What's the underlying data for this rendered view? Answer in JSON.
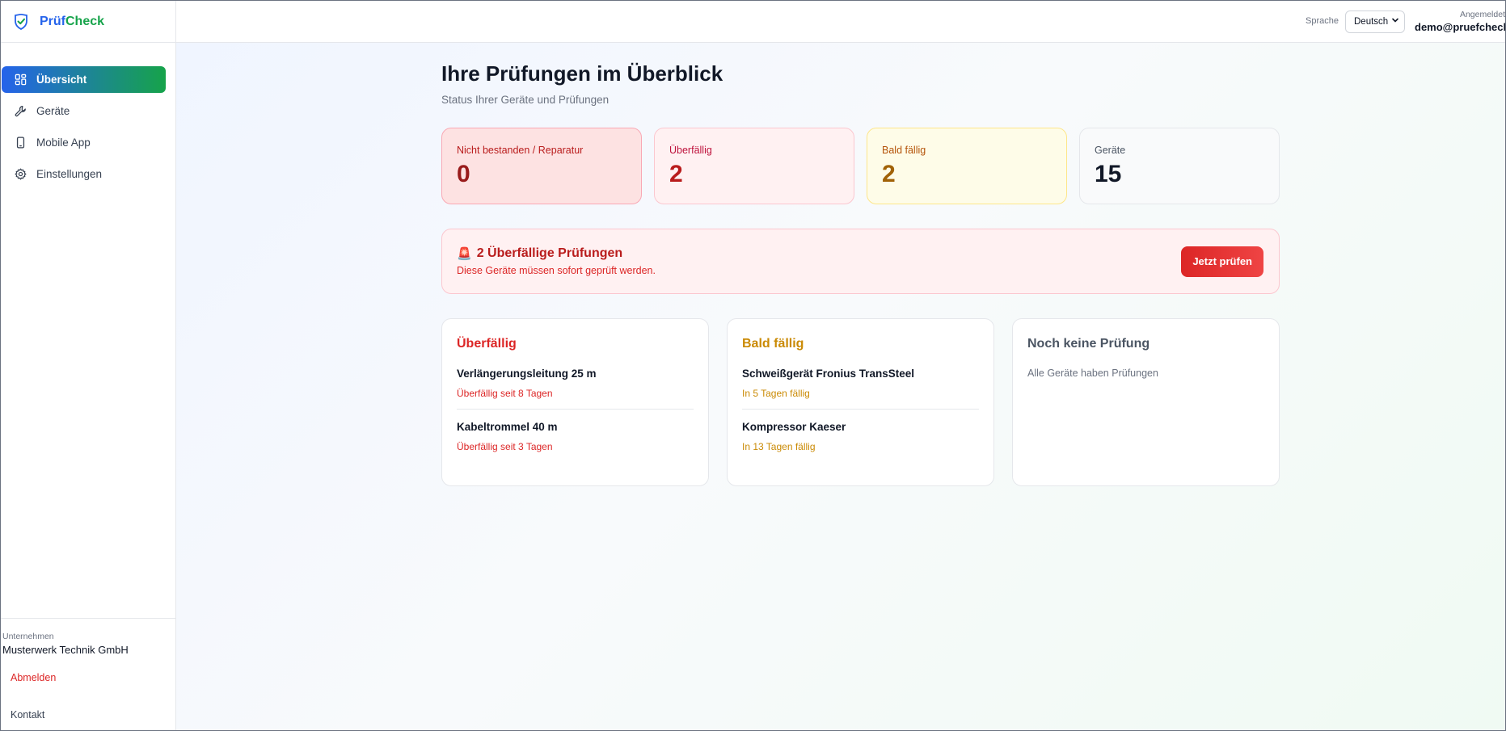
{
  "brand": {
    "name_part1": "Prüf",
    "name_part2": "Check",
    "icon": "shield-check-icon"
  },
  "sidebar": {
    "items": [
      {
        "label": "Übersicht",
        "icon": "grid-icon",
        "active": true
      },
      {
        "label": "Geräte",
        "icon": "wrench-icon",
        "active": false
      },
      {
        "label": "Mobile App",
        "icon": "smartphone-icon",
        "active": false
      },
      {
        "label": "Einstellungen",
        "icon": "gear-icon",
        "active": false
      }
    ],
    "company_label": "Unternehmen",
    "company_name": "Musterwerk Technik GmbH",
    "logout": "Abmelden",
    "contact": "Kontakt"
  },
  "topbar": {
    "language_label": "Sprache",
    "language_value": "Deutsch",
    "user_label": "Angemeldet",
    "user_email": "demo@pruefcheck.de"
  },
  "main": {
    "title": "Ihre Prüfungen im Überblick",
    "subtitle": "Status Ihrer Geräte und Prüfungen",
    "stats": [
      {
        "label": "Nicht bestanden / Reparatur",
        "value": "0",
        "tone": "red"
      },
      {
        "label": "Überfällig",
        "value": "2",
        "tone": "pink"
      },
      {
        "label": "Bald fällig",
        "value": "2",
        "tone": "yellow"
      },
      {
        "label": "Geräte",
        "value": "15",
        "tone": "gray"
      }
    ],
    "alert": {
      "icon": "🚨",
      "title": "2 Überfällige Prüfungen",
      "subtitle": "Diese Geräte müssen sofort geprüft werden.",
      "button": "Jetzt prüfen"
    },
    "cards": {
      "overdue": {
        "title": "Überfällig",
        "items": [
          {
            "name": "Verlängerungsleitung 25 m",
            "status": "Überfällig seit 8 Tagen"
          },
          {
            "name": "Kabeltrommel 40 m",
            "status": "Überfällig seit 3 Tagen"
          }
        ]
      },
      "soon": {
        "title": "Bald fällig",
        "items": [
          {
            "name": "Schweißgerät Fronius TransSteel",
            "status": "In 5 Tagen fällig"
          },
          {
            "name": "Kompressor Kaeser",
            "status": "In 13 Tagen fällig"
          }
        ]
      },
      "none": {
        "title": "Noch keine Prüfung",
        "empty": "Alle Geräte haben Prüfungen"
      }
    }
  },
  "colors": {
    "primary_blue": "#2563eb",
    "primary_green": "#16a34a",
    "danger": "#dc2626",
    "warning": "#ca8a04"
  }
}
